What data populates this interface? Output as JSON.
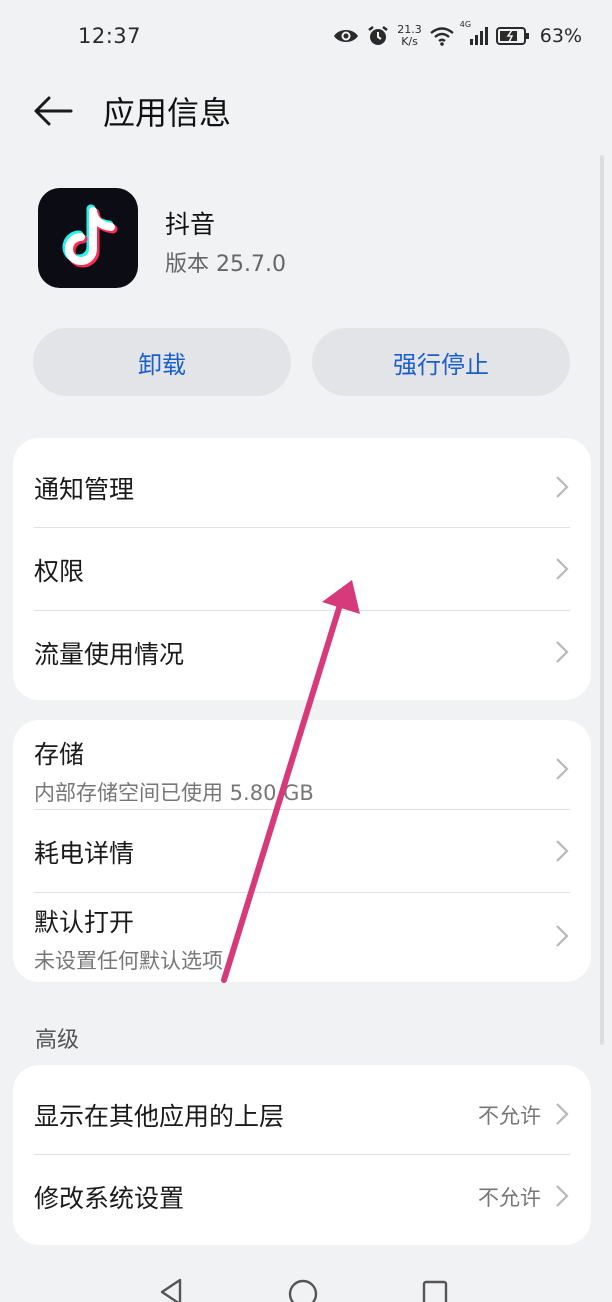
{
  "status_bar": {
    "time": "12:37",
    "net_speed_value": "21.3",
    "net_speed_unit": "K/s",
    "network_type": "4G",
    "battery": "63%",
    "icons": [
      "eye-icon",
      "alarm-icon",
      "wifi-icon",
      "signal-icon",
      "battery-icon"
    ]
  },
  "header": {
    "title": "应用信息"
  },
  "app": {
    "name": "抖音",
    "version": "版本 25.7.0"
  },
  "actions": {
    "uninstall": "卸载",
    "force_stop": "强行停止"
  },
  "card1": {
    "items": [
      {
        "label": "通知管理"
      },
      {
        "label": "权限"
      },
      {
        "label": "流量使用情况"
      }
    ]
  },
  "card2": {
    "items": [
      {
        "label": "存储",
        "sub": "内部存储空间已使用 5.80 GB"
      },
      {
        "label": "耗电详情"
      },
      {
        "label": "默认打开",
        "sub": "未设置任何默认选项"
      }
    ]
  },
  "advanced": {
    "section_label": "高级",
    "items": [
      {
        "label": "显示在其他应用的上层",
        "value": "不允许"
      },
      {
        "label": "修改系统设置",
        "value": "不允许"
      }
    ]
  },
  "colors": {
    "accent": "#1a5fcc",
    "annotation_arrow": "#d63a7a",
    "background": "#f1f2f4"
  }
}
